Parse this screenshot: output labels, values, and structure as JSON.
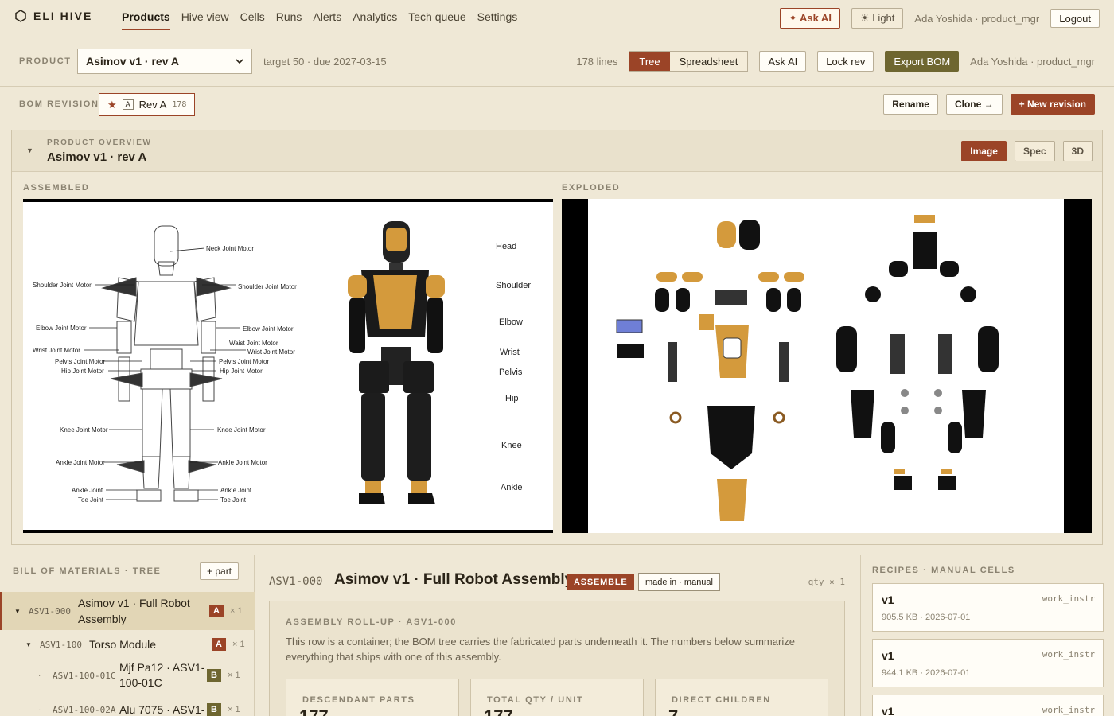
{
  "app": {
    "name": "ELI HIVE"
  },
  "nav": {
    "tabs": [
      "Products",
      "Hive view",
      "Cells",
      "Runs",
      "Alerts",
      "Analytics",
      "Tech queue",
      "Settings"
    ],
    "active": "Products",
    "ask_ai": "✦ Ask AI",
    "theme": "☀ Light",
    "user": "Ada Yoshida · product_mgr",
    "logout": "Logout"
  },
  "product_bar": {
    "label": "PRODUCT",
    "selected": "Asimov v1 · rev A",
    "target": "target 50 · due 2027-03-15",
    "lines": "178 lines",
    "view_tree": "Tree",
    "view_sheet": "Spreadsheet",
    "ask_ai": "Ask AI",
    "lock": "Lock rev",
    "export": "Export BOM",
    "user": "Ada Yoshida · product_mgr"
  },
  "revision_bar": {
    "label": "BOM REVISION",
    "star": "★",
    "letter": "A",
    "name": "Rev A",
    "count": "178",
    "rename": "Rename",
    "clone": "Clone →",
    "new": "+ New revision"
  },
  "overview": {
    "caption": "PRODUCT OVERVIEW",
    "title": "Asimov v1 · rev A",
    "btn_image": "Image",
    "btn_spec": "Spec",
    "btn_3d": "3D",
    "assembled_label": "ASSEMBLED",
    "exploded_label": "EXPLODED",
    "motor_labels": {
      "neck": "Neck Joint Motor",
      "shoulder": "Shoulder Joint Motor",
      "elbow": "Elbow Joint Motor",
      "waist": "Waist Joint Motor",
      "wrist": "Wrist Joint Motor",
      "pelvis": "Pelvis Joint Motor",
      "hip": "Hip Joint Motor",
      "knee": "Knee Joint Motor",
      "ankle_motor": "Ankle Joint Motor",
      "ankle": "Ankle Joint",
      "toe": "Toe Joint"
    },
    "body_labels": [
      "Head",
      "Shoulder",
      "Elbow",
      "Wrist",
      "Pelvis",
      "Hip",
      "Knee",
      "Ankle"
    ]
  },
  "bom": {
    "caption": "BILL OF MATERIALS · TREE",
    "add_part": "+ part",
    "rows": [
      {
        "code": "ASV1-000",
        "name": "Asimov v1 · Full Robot Assembly",
        "badge": "A",
        "qty": "× 1"
      },
      {
        "code": "ASV1-100",
        "name": "Torso Module",
        "badge": "A",
        "qty": "× 1"
      },
      {
        "code": "ASV1-100-01C",
        "name": "Mjf Pa12 · ASV1-100-01C",
        "badge": "B",
        "qty": "× 1"
      },
      {
        "code": "ASV1-100-02A",
        "name": "Alu 7075 · ASV1-",
        "badge": "B",
        "qty": "× 1"
      }
    ]
  },
  "detail": {
    "code": "ASV1-000",
    "title": "Asimov v1 · Full Robot Assembly",
    "kind": "ASSEMBLE",
    "made_in": "made in · manual",
    "qty": "qty × 1",
    "rollup_caption": "ASSEMBLY ROLL-UP · ASV1-000",
    "rollup_text": "This row is a container; the BOM tree carries the fabricated parts underneath it. The numbers below summarize everything that ships with one of this assembly.",
    "stats": [
      {
        "label": "DESCENDANT PARTS",
        "value": "177"
      },
      {
        "label": "TOTAL QTY / UNIT",
        "value": "177"
      },
      {
        "label": "DIRECT CHILDREN",
        "value": "7"
      }
    ]
  },
  "recipes": {
    "caption": "RECIPES · MANUAL CELLS",
    "items": [
      {
        "version": "v1",
        "type": "work_instr",
        "meta": "905.5 KB · 2026-07-01"
      },
      {
        "version": "v1",
        "type": "work_instr",
        "meta": "944.1 KB · 2026-07-01"
      },
      {
        "version": "v1",
        "type": "work_instr",
        "meta": ""
      }
    ]
  },
  "colors": {
    "accent": "#9b4427",
    "olive": "#6e6630",
    "background": "#efe8d6"
  }
}
